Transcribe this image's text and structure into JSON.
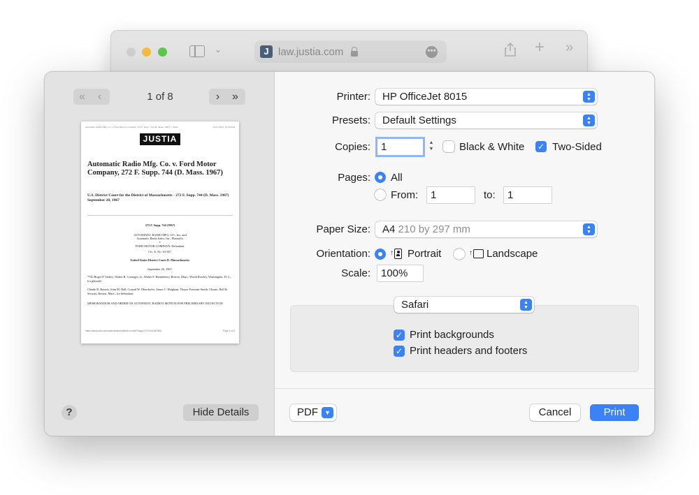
{
  "browser": {
    "address": "law.justia.com",
    "favicon_letter": "J",
    "more_glyph": "•••"
  },
  "preview": {
    "page_indicator": "1 of 8",
    "thumbnail": {
      "header_left": "Automatic Radio Mfg. Co. v. Ford Motor Company, 272 F. Supp. 744 (D. Mass. 1967) :: Justia",
      "header_right": "10/21/2021, 10:36 AM",
      "logo": "JUSTIA",
      "title": "Automatic Radio Mfg. Co. v. Ford Motor Company, 272 F. Supp. 744 (D. Mass. 1967)",
      "court_line": "U.S. District Court for the District of Massachusetts - 272 F. Supp. 744 (D. Mass. 1967)",
      "date_line": "September 20, 1967",
      "citation": "272 F. Supp. 744 (1967)",
      "parties_1": "AUTOMATIC RADIO MFG. CO., Inc. and",
      "parties_2": "Automatic Radio Sales, Inc., Plaintiffs,",
      "parties_3": "v.",
      "parties_4": "FORD MOTOR COMPANY, Defendant.",
      "case_no": "Civ. A. No. 63-367.",
      "court": "United States District Court D. Massachusetts.",
      "decided": "September 20, 1967.",
      "counsel_1": "*745 Roger P. Stokey, Walter B. Comegys, Jr., Walter F. Henneberry, Boston, Mass., Worth Rowley, Washington, D. C., for plaintiff.",
      "counsel_2": "Claude R. Branch, John M. Hall, Conrad W. Oberdorfer, James C. Heigham, Thayer Fremont-Smith, Choate, Hall & Stewart, Boston, Mass., for defendant.",
      "memo": "MEMORANDUM AND ORDER ON AUTOMATIC RADIO'S MOTION FOR PRELIMINARY INJUNCTION",
      "footer_left": "https://law.justia.com/cases/federal/district-courts/FSupp/272/744/1967581/",
      "footer_right": "Page 1 of 8"
    },
    "help_label": "?",
    "hide_details_label": "Hide Details"
  },
  "settings": {
    "printer_label": "Printer:",
    "printer_value": "HP OfficeJet 8015",
    "presets_label": "Presets:",
    "presets_value": "Default Settings",
    "copies_label": "Copies:",
    "copies_value": "1",
    "black_white_label": "Black & White",
    "black_white_checked": false,
    "two_sided_label": "Two-Sided",
    "two_sided_checked": true,
    "pages_label": "Pages:",
    "pages_all_label": "All",
    "pages_from_label": "From:",
    "pages_from_value": "1",
    "pages_to_label": "to:",
    "pages_to_value": "1",
    "paper_size_label": "Paper Size:",
    "paper_size_value": "A4",
    "paper_size_dims": "210 by 297 mm",
    "orientation_label": "Orientation:",
    "portrait_label": "Portrait",
    "landscape_label": "Landscape",
    "scale_label": "Scale:",
    "scale_value": "100%",
    "app_section": "Safari",
    "print_backgrounds_label": "Print backgrounds",
    "print_backgrounds_checked": true,
    "print_headers_label": "Print headers and footers",
    "print_headers_checked": true
  },
  "footer": {
    "pdf_label": "PDF",
    "cancel_label": "Cancel",
    "print_label": "Print"
  },
  "colors": {
    "accent": "#3b82f6",
    "traffic_min": "#f5be3c",
    "traffic_max": "#5ec84e"
  }
}
